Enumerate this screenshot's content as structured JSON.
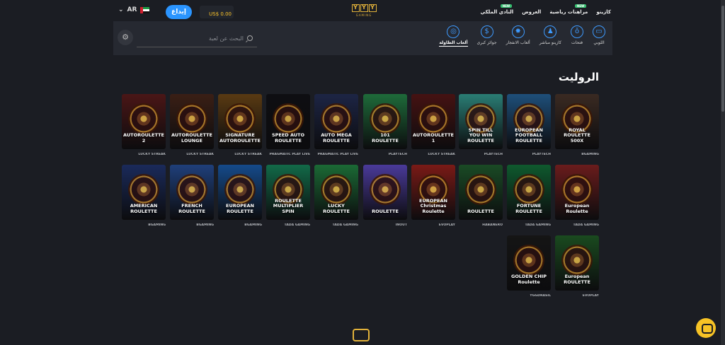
{
  "header": {
    "language": "AR",
    "deposit_label": "إيداع",
    "balance": "US$ 0.00",
    "logo_text": "GAMING",
    "nav": [
      {
        "label": "كازينو",
        "badge": ""
      },
      {
        "label": "مراهنات رياضية",
        "badge": "NEW"
      },
      {
        "label": "العروض",
        "badge": ""
      },
      {
        "label": "النادي الملكي",
        "badge": "NEW"
      }
    ]
  },
  "categories": {
    "search_placeholder": "البحث عن لعبة",
    "items": [
      {
        "label": "اللوبي",
        "icon": "couch-icon"
      },
      {
        "label": "فتحات",
        "icon": "cherries-icon"
      },
      {
        "label": "كازينو مباشر",
        "icon": "dealer-icon"
      },
      {
        "label": "ألعاب الانفجار",
        "icon": "explosion-icon"
      },
      {
        "label": "جوائز كبرى",
        "icon": "money-bag-icon"
      },
      {
        "label": "ألعاب الطاولة",
        "icon": "roulette-icon"
      }
    ]
  },
  "section_title": "الروليت",
  "games": [
    {
      "name": "ROYAL\nROULETTE\n500X",
      "provider": "BGAMING",
      "color": "#3a2a22"
    },
    {
      "name": "EUROPEAN\nFOOTBALL\nROULETTE",
      "provider": "PLAYTECH",
      "color": "#1e4f7a"
    },
    {
      "name": "SPIN TILL\nYOU WIN\nROULETTE",
      "provider": "PLAYTECH",
      "color": "#2a7d74"
    },
    {
      "name": "AUTOROULETTE\n1",
      "provider": "LUCKY STREAK",
      "color": "#451212"
    },
    {
      "name": "101\nROULETTE",
      "provider": "PLAYTECH",
      "color": "#1e6b3a"
    },
    {
      "name": "AUTO MEGA\nROULETTE",
      "provider": "PRAGMATIC PLAY LIVE",
      "color": "#1d2545"
    },
    {
      "name": "SPEED AUTO\nROULETTE",
      "provider": "PRAGMATIC PLAY LIVE",
      "color": "#0e0e12"
    },
    {
      "name": "SIGNATURE\nAUTOROULETTE",
      "provider": "LUCKY STREAK",
      "color": "#5a3a12"
    },
    {
      "name": "AUTOROULETTE\nLOUNGE",
      "provider": "LUCKY STREAK",
      "color": "#3a1f15"
    },
    {
      "name": "AUTOROULETTE\n2",
      "provider": "LUCKY STREAK",
      "color": "#4a1616"
    },
    {
      "name": "European\nRoulette",
      "provider": "TADA GAMING",
      "color": "#6a1c1c"
    },
    {
      "name": "FORTUNE\nROULETTE",
      "provider": "TADA GAMING",
      "color": "#0f5a2e"
    },
    {
      "name": "ROULETTE",
      "provider": "HABANERO",
      "color": "#1a4a25"
    },
    {
      "name": "EUROPEAN\nChristmas Roulette",
      "provider": "EVOPLAY",
      "color": "#7a1a16"
    },
    {
      "name": "ROULETTE",
      "provider": "INOUT",
      "color": "#4a3a9a"
    },
    {
      "name": "LUCKY\nROULETTE",
      "provider": "TADA GAMING",
      "color": "#1b6a35"
    },
    {
      "name": "ROULETTE\nMULTIPLIER\nSPIN",
      "provider": "TADA GAMING",
      "color": "#126a48"
    },
    {
      "name": "EUROPEAN\nROULETTE",
      "provider": "BGAMING",
      "color": "#154a8a"
    },
    {
      "name": "FRENCH\nROULETTE",
      "provider": "BGAMING",
      "color": "#1f3f7a"
    },
    {
      "name": "AMERICAN\nROULETTE",
      "provider": "BGAMING",
      "color": "#1a2a5a"
    },
    {
      "name": "European\nROULETTE",
      "provider": "EVOPLAY",
      "color": "#1a4a1f"
    },
    {
      "name": "GOLDEN CHIP\nRoulette",
      "provider": "YGGDRASIL",
      "color": "#151515"
    }
  ],
  "colors": {
    "accent": "#2b95ff",
    "gold": "#e2b23a",
    "chat": "#f7c325"
  }
}
